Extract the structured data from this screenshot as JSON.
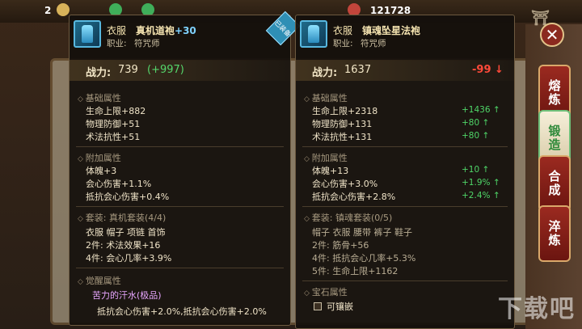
{
  "topbar": {
    "level": "2",
    "coins": "121728"
  },
  "watermark": "下载吧",
  "side_tabs": [
    {
      "label": "熔炼",
      "active": false
    },
    {
      "label": "锻造",
      "active": true
    },
    {
      "label": "合成",
      "active": false
    },
    {
      "label": "淬炼",
      "active": false
    }
  ],
  "close_symbol": "✕",
  "left": {
    "type": "衣服",
    "name": "真机道袍",
    "plus": "+30",
    "job_label": "职业:",
    "job": "符咒师",
    "equipped_badge": "已装备",
    "power_label": "战力:",
    "power": "739",
    "power_diff": "(+997)",
    "base_title": "基础属性",
    "base": [
      "生命上限+882",
      "物理防御+51",
      "术法抗性+51"
    ],
    "extra_title": "附加属性",
    "extra": [
      "体魄+3",
      "会心伤害+1.1%",
      "抵抗会心伤害+0.4%"
    ],
    "set_title": "套装: 真机套装(4/4)",
    "set_items": "衣服  帽子  项链  首饰",
    "set_bonus": [
      "2件: 术法效果+16",
      "4件: 会心几率+3.9%"
    ],
    "awaken_title": "觉醒属性",
    "awaken_name": "苦力的汗水(极品)",
    "awaken_effect": "抵抗会心伤害+2.0%,抵抗会心伤害+2.0%"
  },
  "right": {
    "type": "衣服",
    "name": "镇魂坠星法袍",
    "job_label": "职业:",
    "job": "符咒师",
    "power_label": "战力:",
    "power": "1637",
    "power_diff": "-99",
    "base_title": "基础属性",
    "base": [
      "生命上限+2318",
      "物理防御+131",
      "术法抗性+131"
    ],
    "base_delta": [
      "+1436",
      "+80",
      "+80"
    ],
    "extra_title": "附加属性",
    "extra": [
      "体魄+13",
      "会心伤害+3.0%",
      "抵抗会心伤害+2.8%"
    ],
    "extra_delta": [
      "+10",
      "+1.9%",
      "+2.4%"
    ],
    "set_title": "套装: 镇魂套装(0/5)",
    "set_items": "帽子  衣服  腰带  裤子  鞋子",
    "set_bonus": [
      "2件: 筋骨+56",
      "4件: 抵抗会心几率+5.3%",
      "5件: 生命上限+1162"
    ],
    "gem_title": "宝石属性",
    "gem_slot": "可镶嵌"
  },
  "colors": {
    "increase": "#4fd668",
    "decrease": "#ff4a3a",
    "plus": "#7fd2ff"
  }
}
